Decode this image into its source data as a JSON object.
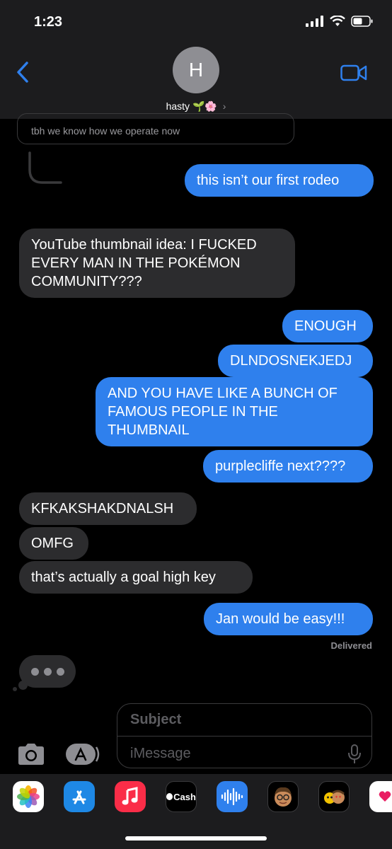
{
  "status_bar": {
    "time": "1:23"
  },
  "header": {
    "avatar_initial": "H",
    "contact_name": "hasty",
    "contact_emoji": "🌱🌸",
    "chevron": "›"
  },
  "reply_preview": {
    "text": "tbh we know how we operate now"
  },
  "messages": [
    {
      "sender": "me",
      "text": "this isn’t our first rodeo"
    },
    {
      "sender": "them",
      "text": "YouTube thumbnail idea: I FUCKED EVERY MAN IN THE POKÉMON COMMUNITY???"
    },
    {
      "sender": "me",
      "text": "ENOUGH"
    },
    {
      "sender": "me",
      "text": "DLNDOSNEKJEDJ"
    },
    {
      "sender": "me",
      "text": "AND YOU HAVE LIKE A BUNCH OF FAMOUS PEOPLE IN THE THUMBNAIL"
    },
    {
      "sender": "me",
      "text": "purplecliffe next????"
    },
    {
      "sender": "them",
      "text": "KFKAKSHAKDNALSH"
    },
    {
      "sender": "them",
      "text": "OMFG"
    },
    {
      "sender": "them",
      "text": "that’s actually a goal high key"
    },
    {
      "sender": "me",
      "text": "Jan would be easy!!!"
    }
  ],
  "delivery_status": "Delivered",
  "composer": {
    "subject_placeholder": "Subject",
    "message_placeholder": "iMessage"
  },
  "app_drawer": {
    "cash_label": "Cash"
  },
  "colors": {
    "sent_bubble": "#2f80ed",
    "received_bubble": "#2c2c2e",
    "background": "#000000",
    "accent": "#2f80ed"
  }
}
